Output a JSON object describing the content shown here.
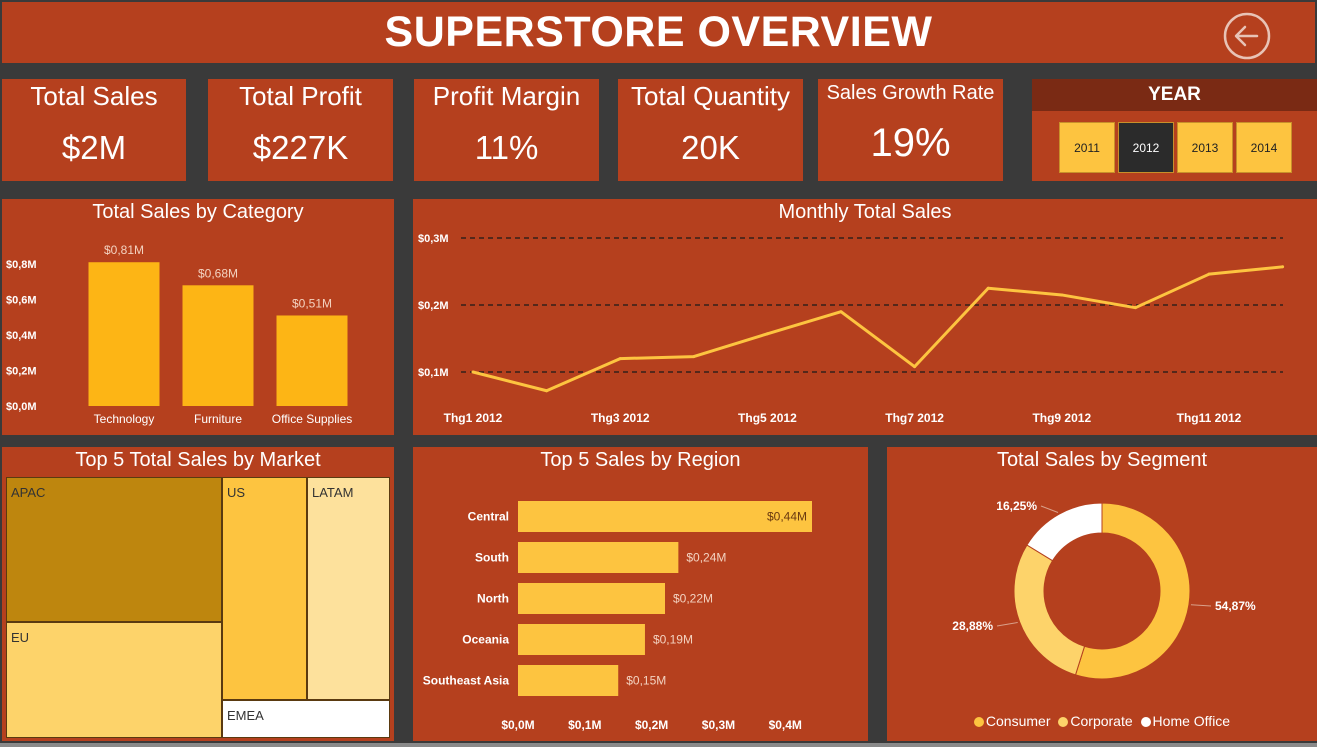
{
  "header": {
    "title": "SUPERSTORE OVERVIEW",
    "back_icon": "back-arrow-icon"
  },
  "kpis": [
    {
      "label": "Total Sales",
      "value": "$2M"
    },
    {
      "label": "Total Profit",
      "value": "$227K"
    },
    {
      "label": "Profit Margin",
      "value": "11%"
    },
    {
      "label": "Total Quantity",
      "value": "20K"
    },
    {
      "label": "Sales Growth Rate",
      "value": "19%"
    }
  ],
  "year_filter": {
    "title": "YEAR",
    "options": [
      "2011",
      "2012",
      "2013",
      "2014"
    ],
    "selected": "2012"
  },
  "colors": {
    "panel": "#b5401e",
    "background": "#3a3a3a",
    "bar": "#fdb515",
    "accent": "#fdc440",
    "selected": "#2b2b2b"
  },
  "chart_data": [
    {
      "type": "bar",
      "title": "Total Sales by Category",
      "categories": [
        "Technology",
        "Furniture",
        "Office Supplies"
      ],
      "values": [
        0.81,
        0.68,
        0.51
      ],
      "data_labels": [
        "$0,81M",
        "$0,68M",
        "$0,51M"
      ],
      "yticks": [
        "$0,0M",
        "$0,2M",
        "$0,4M",
        "$0,6M",
        "$0,8M"
      ],
      "ylim": [
        0,
        0.8
      ]
    },
    {
      "type": "line",
      "title": "Monthly Total Sales",
      "x": [
        "Thg1 2012",
        "Thg2 2012",
        "Thg3 2012",
        "Thg4 2012",
        "Thg5 2012",
        "Thg6 2012",
        "Thg7 2012",
        "Thg8 2012",
        "Thg9 2012",
        "Thg10 2012",
        "Thg11 2012",
        "Thg12 2012"
      ],
      "values": [
        0.1,
        0.072,
        0.12,
        0.123,
        0.157,
        0.19,
        0.108,
        0.225,
        0.215,
        0.196,
        0.246,
        0.257
      ],
      "xticks": [
        "Thg1 2012",
        "Thg3 2012",
        "Thg5 2012",
        "Thg7 2012",
        "Thg9 2012",
        "Thg11 2012"
      ],
      "yticks": [
        "$0,1M",
        "$0,2M",
        "$0,3M"
      ],
      "ylim": [
        0.1,
        0.3
      ],
      "grid": "dashed"
    },
    {
      "type": "treemap",
      "title": "Top 5 Total Sales by Market",
      "categories": [
        "APAC",
        "EU",
        "US",
        "LATAM",
        "EMEA"
      ],
      "colors": [
        "#be860e",
        "#fdd36a",
        "#fdc440",
        "#fde19c",
        "#ffffff"
      ]
    },
    {
      "type": "bar",
      "orientation": "horizontal",
      "title": "Top 5 Sales by Region",
      "categories": [
        "Central",
        "South",
        "North",
        "Oceania",
        "Southeast Asia"
      ],
      "values": [
        0.44,
        0.24,
        0.22,
        0.19,
        0.15
      ],
      "data_labels": [
        "$0,44M",
        "$0,24M",
        "$0,22M",
        "$0,19M",
        "$0,15M"
      ],
      "xticks": [
        "$0,0M",
        "$0,1M",
        "$0,2M",
        "$0,3M",
        "$0,4M"
      ],
      "xlim": [
        0,
        0.44
      ]
    },
    {
      "type": "pie",
      "title": "Total Sales by Segment",
      "categories": [
        "Consumer",
        "Corporate",
        "Home Office"
      ],
      "values": [
        54.87,
        28.88,
        16.25
      ],
      "data_labels": [
        "54,87%",
        "28,88%",
        "16,25%"
      ],
      "colors": [
        "#fdc440",
        "#fdd36a",
        "#ffffff"
      ],
      "legend": "bottom"
    }
  ]
}
